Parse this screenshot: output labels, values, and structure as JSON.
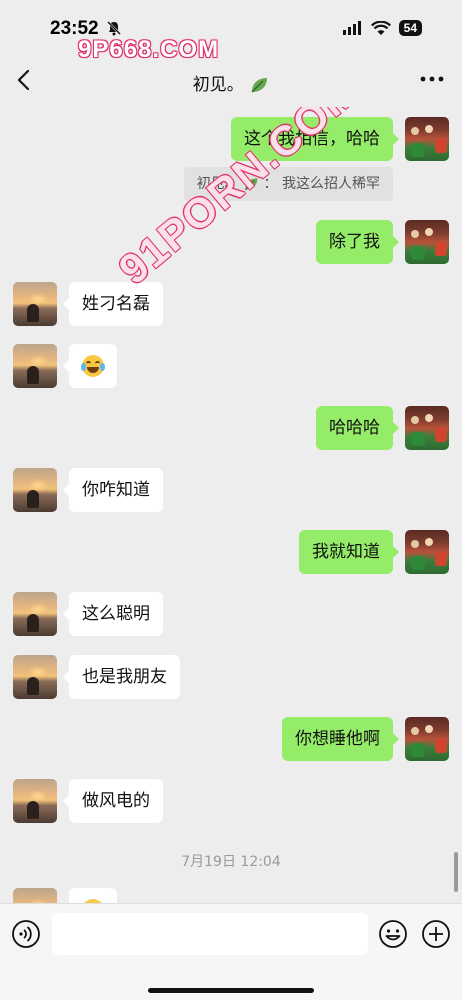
{
  "status_bar": {
    "time": "23:52",
    "battery": "54"
  },
  "watermark": {
    "top": "9P668.COM",
    "diagonal": "91PORN.COM"
  },
  "header": {
    "title": "初见。"
  },
  "messages": [
    {
      "side": "out",
      "text": "这个我相信，哈哈"
    },
    {
      "side": "quote",
      "sender": "初见。",
      "text": "我这么招人稀罕"
    },
    {
      "side": "out",
      "text": "除了我"
    },
    {
      "side": "in",
      "text": "姓刁名磊"
    },
    {
      "side": "in",
      "emoji": "joy-emoji"
    },
    {
      "side": "out",
      "text": "哈哈哈"
    },
    {
      "side": "in",
      "text": "你咋知道"
    },
    {
      "side": "out",
      "text": "我就知道"
    },
    {
      "side": "in",
      "text": "这么聪明"
    },
    {
      "side": "in",
      "text": "也是我朋友"
    },
    {
      "side": "out",
      "text": "你想睡他啊"
    },
    {
      "side": "in",
      "text": "做风电的"
    },
    {
      "side": "timestamp",
      "text": "7月19日 12:04"
    },
    {
      "side": "in",
      "emoji": "partial-emoji"
    }
  ],
  "colors": {
    "out_bubble": "#95ec69",
    "in_bubble": "#ffffff",
    "background": "#ededed"
  }
}
